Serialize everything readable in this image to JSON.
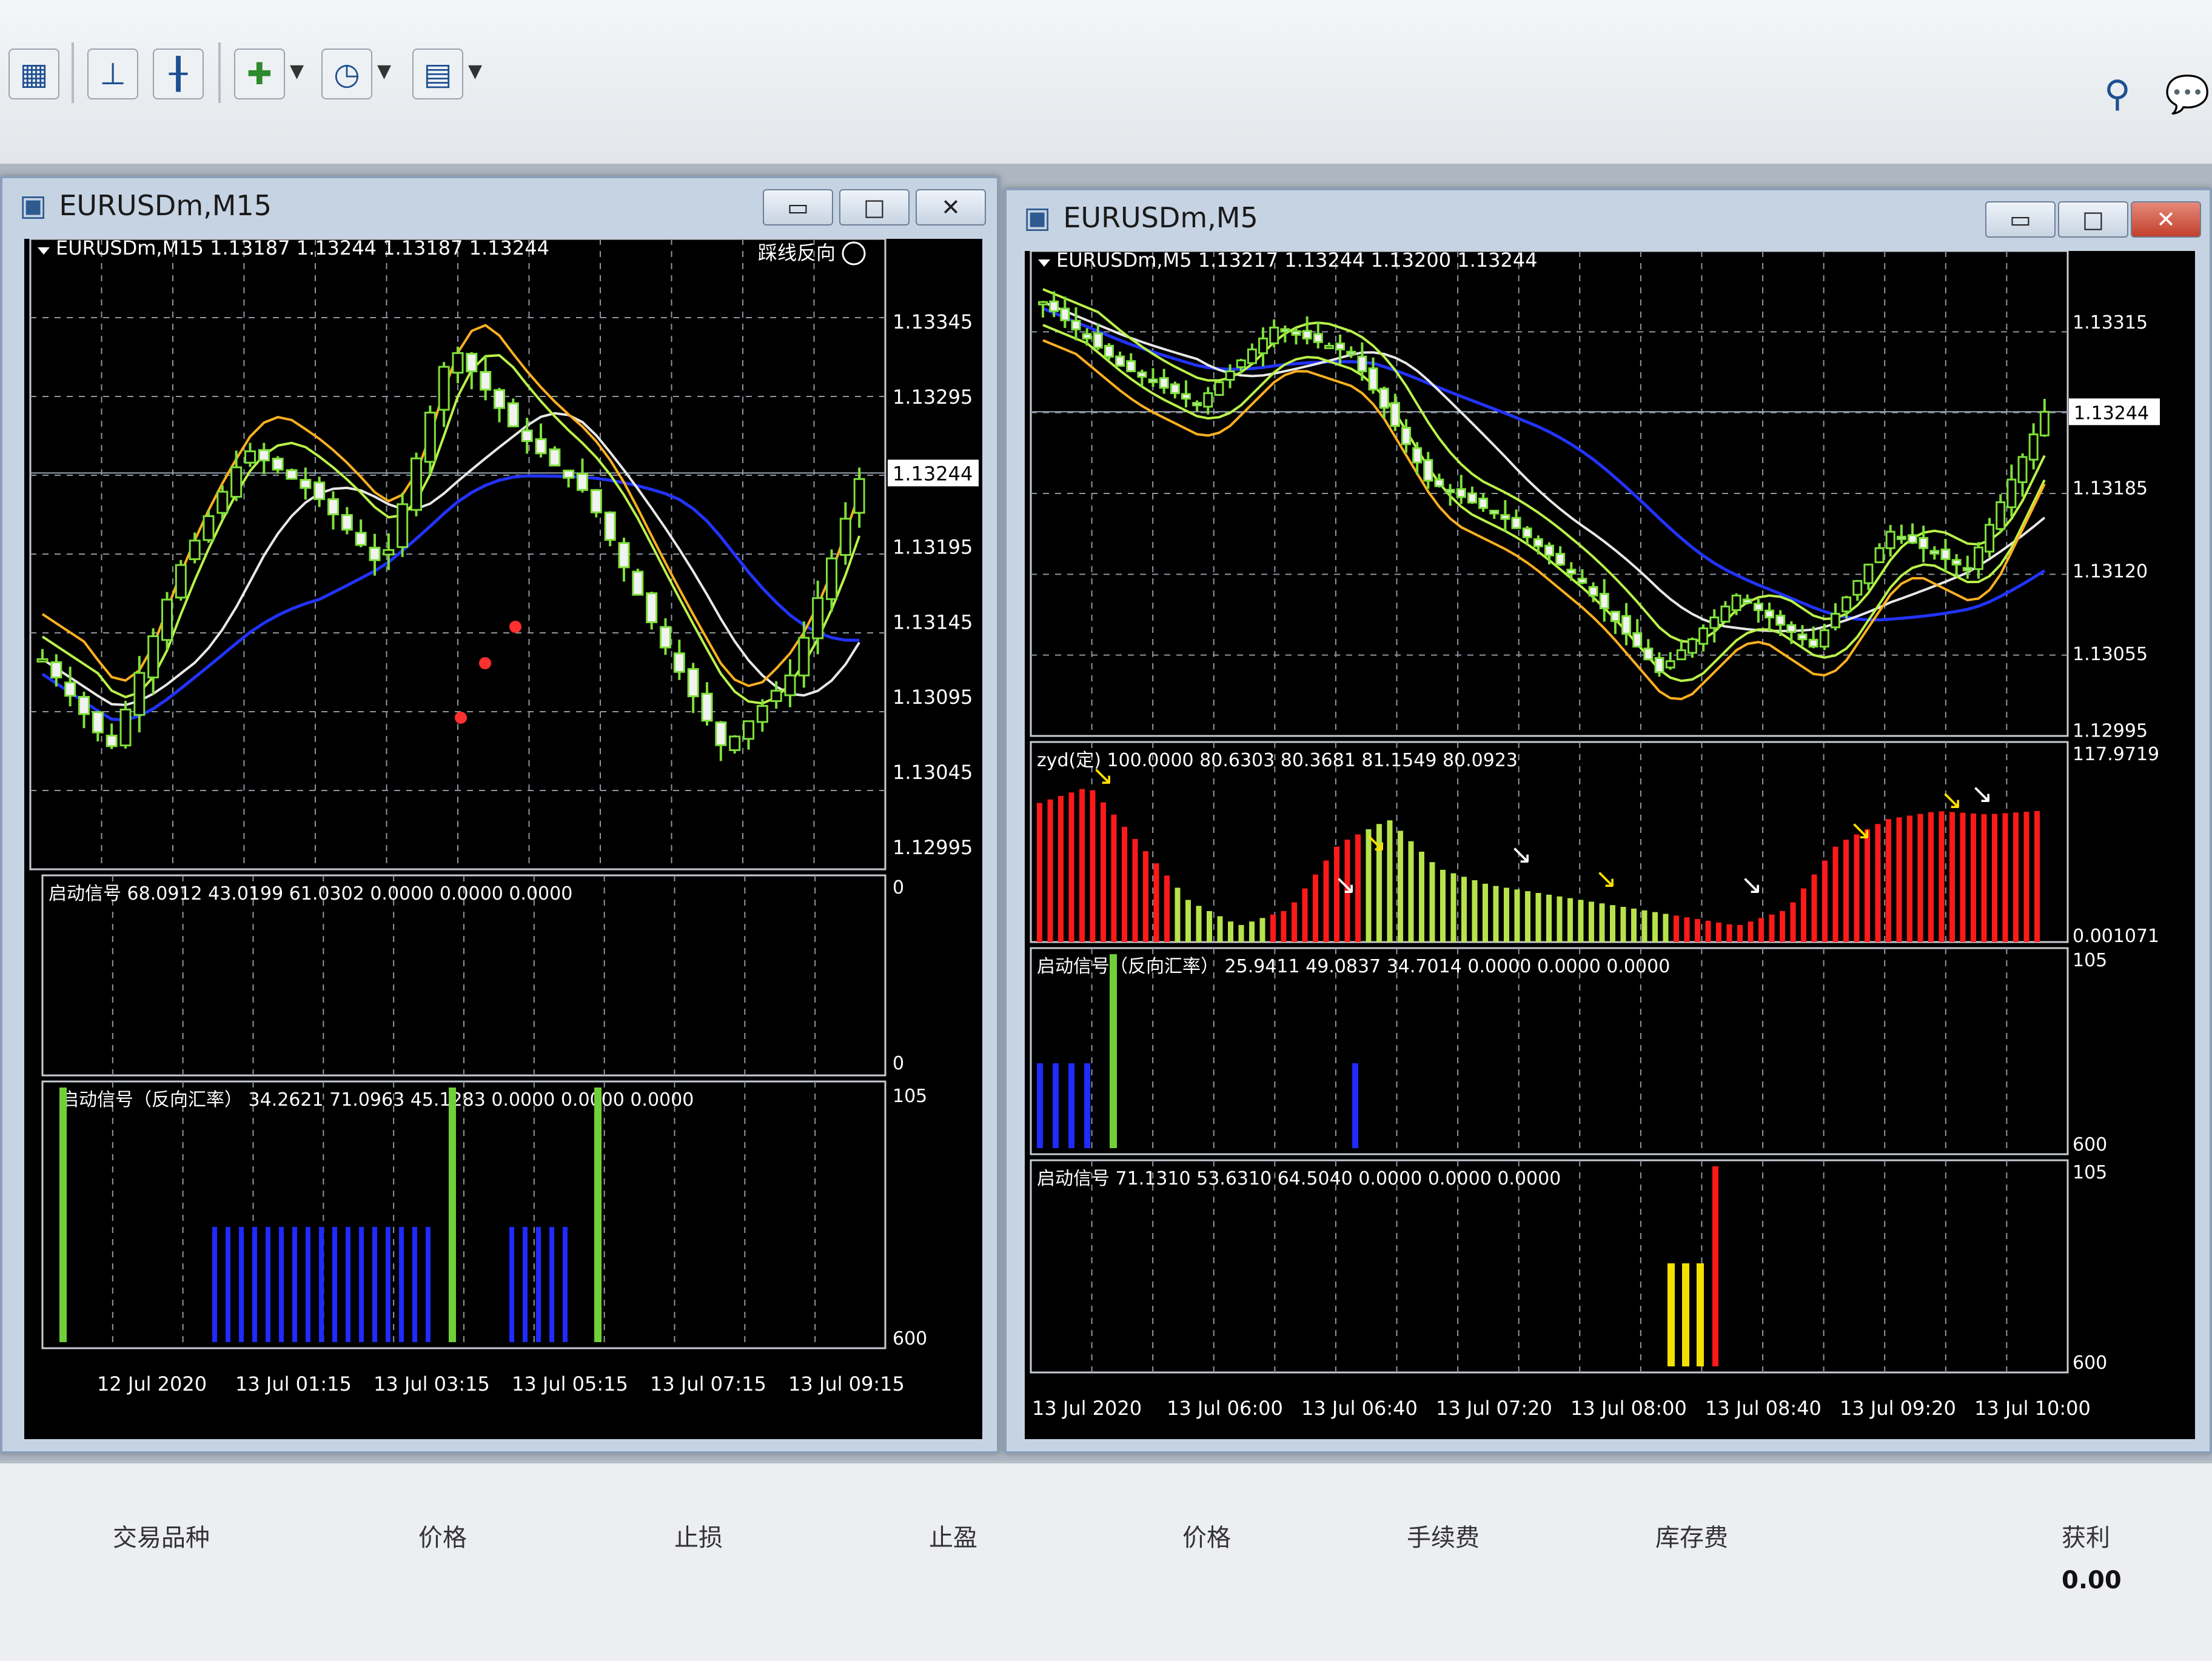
{
  "toolbar": {
    "icons": [
      "grid-icon",
      "chart-bar-icon",
      "chart-step-icon",
      "add-chart-icon",
      "clock-icon",
      "template-icon"
    ],
    "search_icon": "search-icon",
    "chat_icon": "chat-icon"
  },
  "left_window": {
    "title": "EURUSDm,M15",
    "header": "EURUSDm,M15  1.13187 1.13244 1.13187 1.13244",
    "corner_label": "踩线反向",
    "price_ticks": [
      "1.13345",
      "1.13295",
      "1.13244",
      "1.13195",
      "1.13145",
      "1.13095",
      "1.13045",
      "1.12995"
    ],
    "current_price": "1.13244",
    "ind1_label": "启动信号 68.0912 43.0199 61.0302 0.0000 0.0000 0.0000",
    "ind1_ticks": [
      "0",
      "0"
    ],
    "ind2_label": "启动信号（反向汇率） 34.2621 71.0963 45.1283 0.0000 0.0000 0.0000",
    "ind2_ticks": [
      "105",
      "600"
    ],
    "time_labels": [
      "12 Jul 2020",
      "13 Jul 01:15",
      "13 Jul 03:15",
      "13 Jul 05:15",
      "13 Jul 07:15",
      "13 Jul 09:15"
    ]
  },
  "right_window": {
    "title": "EURUSDm,M5",
    "header": "EURUSDm,M5  1.13217 1.13244 1.13200 1.13244",
    "price_ticks": [
      "1.13315",
      "1.13185",
      "1.13120",
      "1.13055",
      "1.12995"
    ],
    "current_price": "1.13244",
    "ind1_label": "zyd(定) 100.0000 80.6303 80.3681 81.1549 80.0923",
    "ind1_ticks": [
      "117.9719",
      "0.001071"
    ],
    "ind2_label": "启动信号（反向汇率） 25.9411 49.0837 34.7014 0.0000 0.0000 0.0000",
    "ind2_ticks": [
      "105",
      "600"
    ],
    "ind3_label": "启动信号 71.1310 53.6310 64.5040 0.0000 0.0000 0.0000",
    "ind3_ticks": [
      "105",
      "600"
    ],
    "time_labels": [
      "13 Jul 2020",
      "13 Jul 06:00",
      "13 Jul 06:40",
      "13 Jul 07:20",
      "13 Jul 08:00",
      "13 Jul 08:40",
      "13 Jul 09:20",
      "13 Jul 10:00"
    ]
  },
  "window_buttons": {
    "minimize": "▭",
    "maximize": "□",
    "close": "✕"
  },
  "terminal": {
    "columns": [
      "交易品种",
      "价格",
      "止损",
      "止盈",
      "价格",
      "手续费",
      "库存费",
      "获利"
    ],
    "profit": "0.00"
  }
}
